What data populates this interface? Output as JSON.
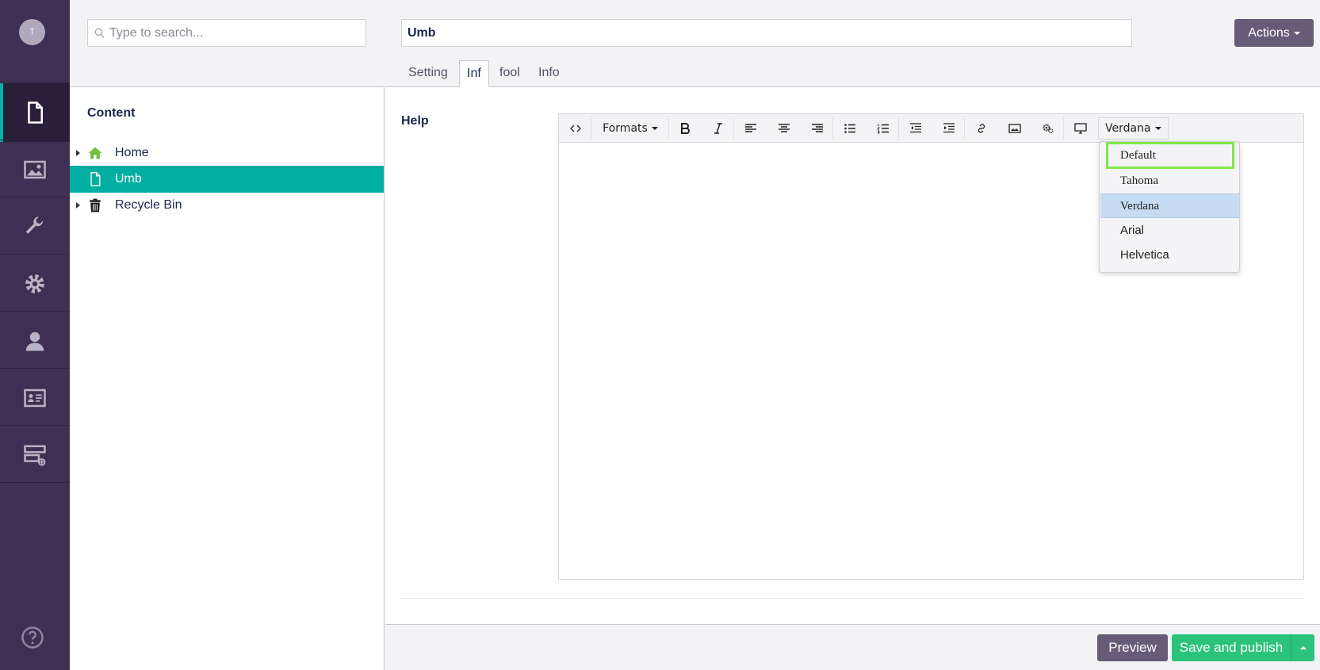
{
  "user": {
    "initial": "T"
  },
  "nav": {
    "sections": [
      {
        "name": "content",
        "icon": "document-icon",
        "active": true
      },
      {
        "name": "media",
        "icon": "image-icon"
      },
      {
        "name": "settings",
        "icon": "wrench-icon"
      },
      {
        "name": "packages",
        "icon": "gear-icon"
      },
      {
        "name": "users",
        "icon": "user-icon"
      },
      {
        "name": "members",
        "icon": "id-card-icon"
      },
      {
        "name": "forms",
        "icon": "form-icon"
      }
    ],
    "help_icon": "question-circle-icon"
  },
  "search": {
    "placeholder": "Type to search..."
  },
  "tree": {
    "section_title": "Content",
    "nodes": [
      {
        "label": "Home",
        "icon": "home-icon",
        "has_children": true
      },
      {
        "label": "Umb",
        "icon": "document-icon",
        "selected": true
      },
      {
        "label": "Recycle Bin",
        "icon": "trash-icon",
        "has_children": true
      }
    ]
  },
  "editor": {
    "name_value": "Umb",
    "actions_label": "Actions",
    "tabs": [
      {
        "label": "Setting"
      },
      {
        "label": "Inf",
        "active": true
      },
      {
        "label": "fool"
      },
      {
        "label": "Info"
      }
    ],
    "property_label": "Help",
    "toolbar": {
      "formats_label": "Formats",
      "font_label": "Verdana",
      "buttons": [
        "source-code-icon",
        "bold-icon",
        "italic-icon",
        "align-left-icon",
        "align-center-icon",
        "align-right-icon",
        "bullet-list-icon",
        "numbered-list-icon",
        "outdent-icon",
        "indent-icon",
        "link-icon",
        "image-icon",
        "macro-icon",
        "embed-icon"
      ]
    },
    "font_dropdown": {
      "options": [
        "Default",
        "Tahoma",
        "Verdana",
        "Arial",
        "Helvetica"
      ],
      "highlighted": "Verdana",
      "focused": "Default"
    }
  },
  "footer": {
    "preview_label": "Preview",
    "save_label": "Save and publish"
  },
  "colors": {
    "nav_bg": "#3e3054",
    "accent_teal": "#00aea2",
    "button_purple": "#675c77",
    "button_green": "#2bc37c",
    "focus_outline": "#7ee84a",
    "dropdown_highlight": "#c7dcf2"
  }
}
